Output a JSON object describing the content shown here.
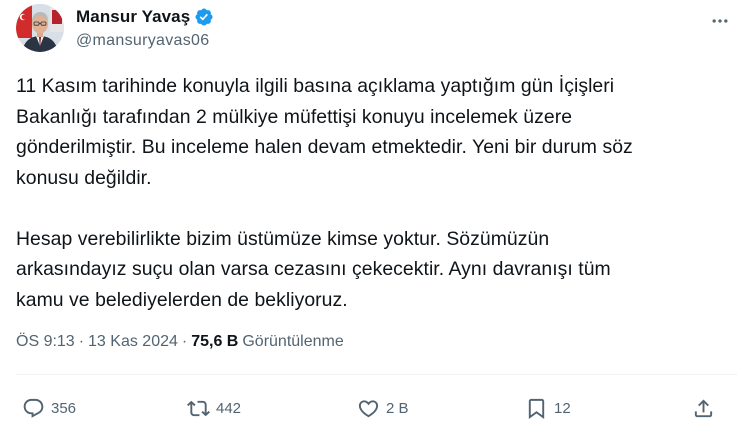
{
  "author": {
    "display_name": "Mansur Yavaş",
    "handle": "@mansuryavas06",
    "verified_icon": "verified-badge-icon",
    "verified_color": "#1d9bf0"
  },
  "tweet": {
    "text": "11 Kasım tarihinde konuyla ilgili basına açıklama yaptığım gün İçişleri\nBakanlığı tarafından 2 mülkiye müfettişi konuyu incelemek üzere\ngönderilmiştir. Bu inceleme halen devam etmektedir. Yeni bir durum söz\nkonusu değildir.\n\nHesap verebilirlikte bizim üstümüze kimse yoktur. Sözümüzün\narkasındayız suçu olan varsa cezasını çekecektir. Aynı davranışı tüm\nkamu ve belediyelerden de bekliyoruz."
  },
  "meta": {
    "time": "ÖS 9:13",
    "separator": "·",
    "date": "13 Kas 2024",
    "views_count": "75,6 B",
    "views_label": "Görüntülenme"
  },
  "actions": {
    "reply": {
      "icon": "reply-icon",
      "count": "356"
    },
    "repost": {
      "icon": "repost-icon",
      "count": "442"
    },
    "like": {
      "icon": "heart-icon",
      "count": "2 B"
    },
    "bookmark": {
      "icon": "bookmark-icon",
      "count": "12"
    },
    "share": {
      "icon": "share-icon"
    }
  },
  "more": {
    "icon": "more-horizontal-icon"
  },
  "colors": {
    "text": "#0f1419",
    "secondary": "#536471",
    "divider": "#eff3f4"
  }
}
